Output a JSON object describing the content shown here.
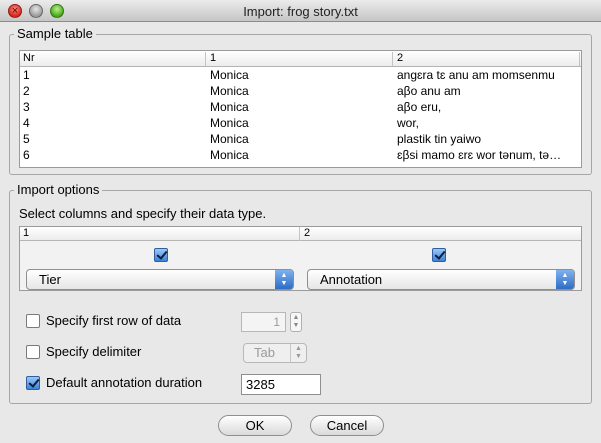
{
  "window": {
    "title": "Import: frog story.txt",
    "close_glyph": "×"
  },
  "sample_table": {
    "label": "Sample table",
    "columns": [
      "Nr",
      "1",
      "2"
    ],
    "rows": [
      [
        "1",
        "Monica",
        "angɛra tɛ anu am momsenmu"
      ],
      [
        "2",
        "Monica",
        "aβo anu am"
      ],
      [
        "3",
        "Monica",
        "aβo eru,"
      ],
      [
        "4",
        "Monica",
        "wor,"
      ],
      [
        "5",
        "Monica",
        "plastik tin yaiwo"
      ],
      [
        "6",
        "Monica",
        "ɛβsi mamo ɛrɛ wor tənum, tə…"
      ]
    ]
  },
  "import_options": {
    "label": "Import options",
    "instruction": "Select columns and specify their data type.",
    "columns": [
      {
        "header": "1",
        "checked": true,
        "type": "Tier"
      },
      {
        "header": "2",
        "checked": true,
        "type": "Annotation"
      }
    ],
    "first_row": {
      "label": "Specify first row of data",
      "checked": false,
      "value": "1"
    },
    "delimiter": {
      "label": "Specify delimiter",
      "checked": false,
      "value": "Tab"
    },
    "duration": {
      "label": "Default annotation duration",
      "checked": true,
      "value": "3285"
    }
  },
  "buttons": {
    "ok": "OK",
    "cancel": "Cancel"
  },
  "glyphs": {
    "up": "▲",
    "down": "▼"
  },
  "colors": {
    "accent": "#3d82d8",
    "window_bg": "#e8e8e8"
  }
}
